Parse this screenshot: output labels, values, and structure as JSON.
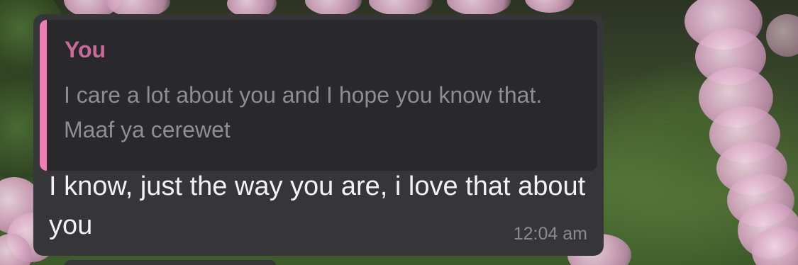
{
  "message": {
    "reply": {
      "author": "You",
      "text": "I care a lot about you and I hope you know that. Maaf ya cerewet",
      "accent_color": "#f07cb4"
    },
    "text": "I know, just the way you are, i love that about you",
    "time": "12:04 am"
  }
}
